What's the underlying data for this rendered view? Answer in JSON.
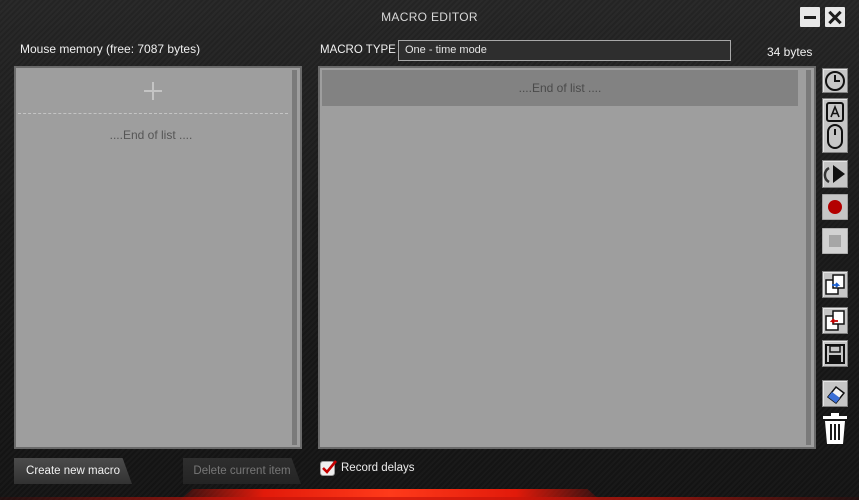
{
  "window": {
    "title": "MACRO EDITOR",
    "minimize_icon": "minimize-icon",
    "close_icon": "close-icon"
  },
  "header": {
    "memory_label": "Mouse memory (free: 7087 bytes)",
    "macro_type_label": "MACRO TYPE",
    "macro_type_value": "One - time mode",
    "bytes_label": "34 bytes"
  },
  "macro_list": {
    "add_icon": "plus-icon",
    "end_of_list": "....End of list ...."
  },
  "macro_content": {
    "end_of_list": "....End of list ...."
  },
  "toolbar": [
    {
      "name": "delay-clock-icon"
    },
    {
      "name": "keyboard-mouse-icon"
    },
    {
      "name": "cursor-action-icon"
    },
    {
      "name": "record-icon"
    },
    {
      "name": "stop-icon"
    },
    {
      "name": "copy-icon"
    },
    {
      "name": "paste-icon"
    },
    {
      "name": "save-icon"
    },
    {
      "name": "eraser-icon"
    },
    {
      "name": "trash-icon"
    }
  ],
  "footer": {
    "create_button": "Create new macro",
    "delete_button": "Delete current item",
    "record_delays_label": "Record delays",
    "record_delays_checked": true
  },
  "colors": {
    "accent_red": "#e21a0a",
    "panel_bg": "#9e9e9e",
    "window_bg": "#1b1b1b"
  }
}
